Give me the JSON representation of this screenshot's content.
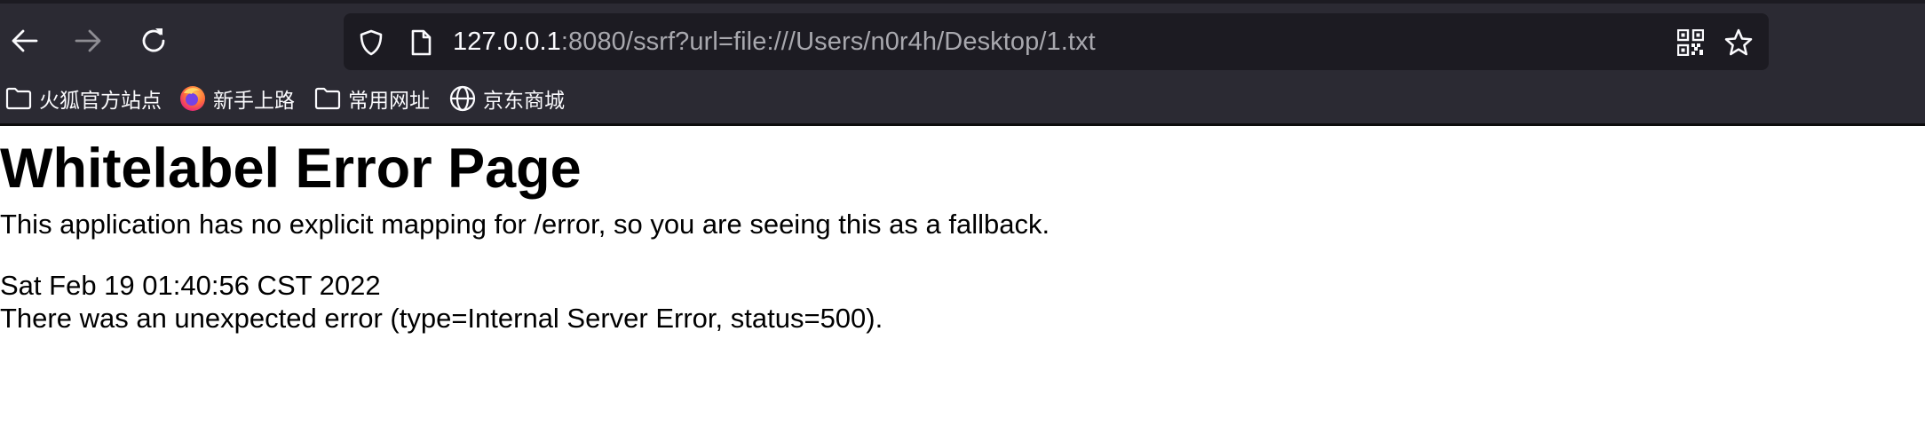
{
  "browser": {
    "url": {
      "host": "127.0.0.1",
      "rest": ":8080/ssrf?url=file:///Users/n0r4h/Desktop/1.txt"
    },
    "bookmarks": [
      {
        "label": "火狐官方站点",
        "icon": "folder-icon"
      },
      {
        "label": "新手上路",
        "icon": "firefox-icon"
      },
      {
        "label": "常用网址",
        "icon": "folder-icon"
      },
      {
        "label": "京东商城",
        "icon": "globe-icon"
      }
    ],
    "colors": {
      "toolbar": "#2b2a33",
      "urlbar": "#1c1b22",
      "text": "#fbfbfe",
      "url_muted": "#a8a8ae"
    }
  },
  "page": {
    "title": "Whitelabel Error Page",
    "description": "This application has no explicit mapping for /error, so you are seeing this as a fallback.",
    "timestamp": "Sat Feb 19 01:40:56 CST 2022",
    "error": "There was an unexpected error (type=Internal Server Error, status=500)."
  }
}
